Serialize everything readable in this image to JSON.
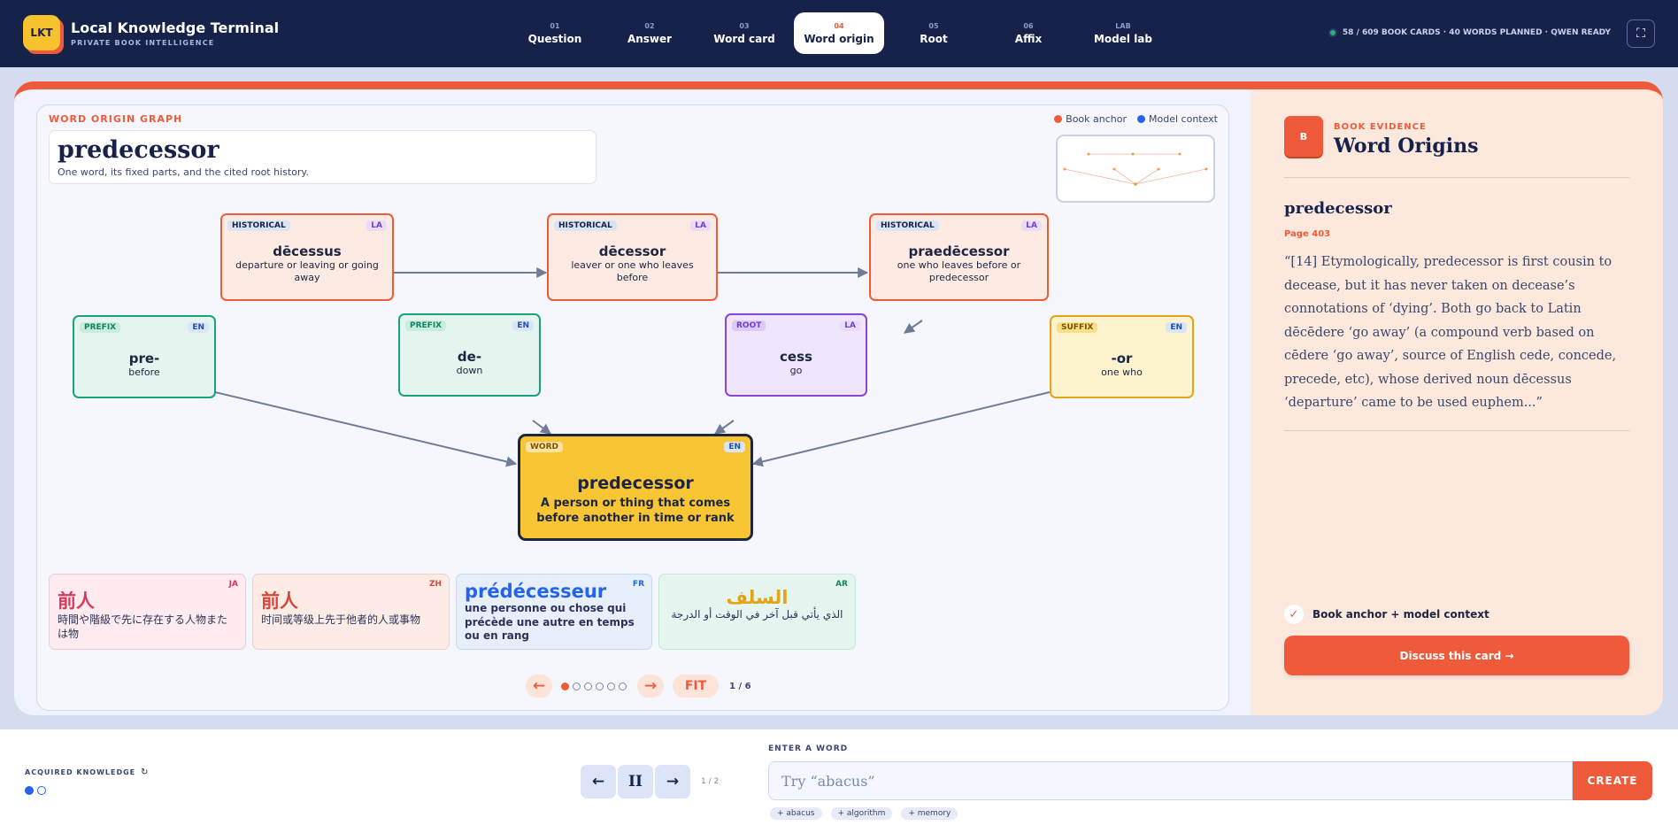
{
  "brand": {
    "logo": "LKT",
    "title": "Local Knowledge Terminal",
    "subtitle": "PRIVATE BOOK INTELLIGENCE"
  },
  "tabs": [
    {
      "num": "01",
      "label": "Question"
    },
    {
      "num": "02",
      "label": "Answer"
    },
    {
      "num": "03",
      "label": "Word card"
    },
    {
      "num": "04",
      "label": "Word origin",
      "active": true
    },
    {
      "num": "05",
      "label": "Root"
    },
    {
      "num": "06",
      "label": "Affix"
    },
    {
      "num": "LAB",
      "label": "Model lab"
    }
  ],
  "status": {
    "text": "58 / 609 BOOK CARDS · 40 WORDS PLANNED · QWEN READY",
    "icon": "online-dot-icon"
  },
  "graph": {
    "heading": "WORD ORIGIN GRAPH",
    "legend": [
      {
        "label": "Book anchor",
        "color": "#ef5b3a"
      },
      {
        "label": "Model context",
        "color": "#2563eb"
      }
    ],
    "word": "predecessor",
    "word_subtitle": "One word, its fixed parts, and the cited root history.",
    "nodes": {
      "hist1": {
        "tag": "HISTORICAL",
        "lang": "LA",
        "title": "dēcessus",
        "desc": "departure or leaving or going away"
      },
      "hist2": {
        "tag": "HISTORICAL",
        "lang": "LA",
        "title": "dēcessor",
        "desc": "leaver or one who leaves before"
      },
      "hist3": {
        "tag": "HISTORICAL",
        "lang": "LA",
        "title": "praedēcessor",
        "desc": "one who leaves before or predecessor"
      },
      "prefix1": {
        "tag": "PREFIX",
        "lang": "EN",
        "title": "pre-",
        "desc": "before"
      },
      "prefix2": {
        "tag": "PREFIX",
        "lang": "EN",
        "title": "de-",
        "desc": "down"
      },
      "root": {
        "tag": "ROOT",
        "lang": "LA",
        "title": "cess",
        "desc": "go"
      },
      "suffix": {
        "tag": "SUFFIX",
        "lang": "EN",
        "title": "-or",
        "desc": "one who"
      },
      "main": {
        "tag": "WORD",
        "lang": "EN",
        "title": "predecessor",
        "desc": "A person or thing that comes before another in time or rank"
      }
    },
    "translations": [
      {
        "code": "JA",
        "word": "前人",
        "desc": "時間や階級で先に存在する人物または物"
      },
      {
        "code": "ZH",
        "word": "前人",
        "desc": "时间或等级上先于他者的人或事物"
      },
      {
        "code": "FR",
        "word": "prédécesseur",
        "desc": "une personne ou chose qui précède une autre en temps ou en rang"
      },
      {
        "code": "AR",
        "word": "السلف",
        "desc": "الذي يأتي قبل آخر في الوقت أو الدرجة"
      }
    ],
    "pager": {
      "prev": "←",
      "next": "→",
      "fit": "FIT",
      "page": "1 / 6",
      "total": 6,
      "current": 1
    }
  },
  "evidence": {
    "badge": "B",
    "kicker": "BOOK EVIDENCE",
    "title": "Word Origins",
    "word": "predecessor",
    "page": "Page 403",
    "quote": "“[14] Etymologically, predecessor is first cousin to decease, but it has never taken on decease’s connotations of ‘dying’. Both go back to Latin dēcēdere ‘go away’ (a compound verb based on cēdere ‘go away’, source of English cede, concede, precede, etc), whose derived noun dēcessus ‘departure’ came to be used euphem...”",
    "check_label": "Book anchor + model context",
    "check_icon": "✓",
    "discuss_label": "Discuss this card →"
  },
  "bottom": {
    "acquired_label": "ACQUIRED KNOWLEDGE",
    "refresh_icon": "↻",
    "dots": [
      true,
      false
    ],
    "prev": "←",
    "pause": "II",
    "next": "→",
    "counter": "1 / 2",
    "enter_label": "ENTER A WORD",
    "placeholder": "Try “abacus”",
    "create_label": "CREATE",
    "chips": [
      "+ abacus",
      "+ algorithm",
      "+ memory"
    ]
  },
  "colors": {
    "accent": "#ef5b3a",
    "navy": "#17224a",
    "gold": "#f8c534",
    "green": "#1aa37a",
    "purple": "#8a44d8"
  }
}
